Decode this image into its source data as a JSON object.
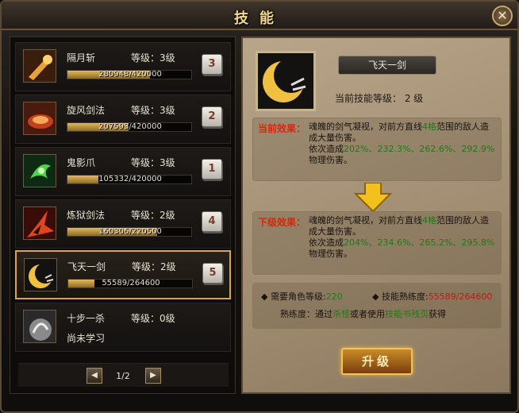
{
  "window": {
    "title": "技能",
    "close_symbol": "✕"
  },
  "skills": [
    {
      "name": "隔月斩",
      "level": "等级：3级",
      "progress": "280948/420000",
      "fraction": 0.669,
      "key": "3",
      "learned": true
    },
    {
      "name": "旋风剑法",
      "level": "等级：3级",
      "progress": "207593/420000",
      "fraction": 0.494,
      "key": "2",
      "learned": true
    },
    {
      "name": "鬼影爪",
      "level": "等级：3级",
      "progress": "105332/420000",
      "fraction": 0.251,
      "key": "1",
      "learned": true
    },
    {
      "name": "炼狱剑法",
      "level": "等级：2级",
      "progress": "160306/220500",
      "fraction": 0.727,
      "key": "4",
      "learned": true
    },
    {
      "name": "飞天一剑",
      "level": "等级：2级",
      "progress": "55589/264600",
      "fraction": 0.21,
      "key": "5",
      "learned": true,
      "selected": true
    },
    {
      "name": "十步一杀",
      "level": "等级：0级",
      "status": "尚未学习",
      "learned": false
    }
  ],
  "pager": {
    "text": "1/2",
    "prev_icon": "◀",
    "next_icon": "▶"
  },
  "detail": {
    "skill_name": "飞天一剑",
    "current_level": "当前技能等级： 2 级",
    "current_effect_label": "当前效果：",
    "current_effect_a": "魂魄的剑气凝视，对前方直线",
    "current_effect_range": "4格",
    "current_effect_b": "范围的敌人造成大量伤害。",
    "current_effect_c": "依次造成",
    "current_effect_vals": "202%、232.3%、262.6%、292.9%",
    "current_effect_d": "物理伤害。",
    "next_effect_label": "下级效果：",
    "next_effect_a": "魂魄的剑气凝视，对前方直线",
    "next_effect_range": "4格",
    "next_effect_b": "范围的敌人造成大量伤害。",
    "next_effect_c": "依次造成",
    "next_effect_vals": "204%、234.6%、265.2%、295.8%",
    "next_effect_d": "物理伤害。",
    "req_level_label": "需要角色等级:",
    "req_level_value": "220",
    "proficiency_label": "技能熟练度:",
    "proficiency_value": "55589/264600",
    "hint_a": "熟练度：通过",
    "hint_b": "杀怪",
    "hint_c": "或者使用",
    "hint_d": "技能书残页",
    "hint_e": "获得",
    "upgrade_label": "升级"
  },
  "colors": {
    "accent": "#d9a642",
    "green": "#1f7a12",
    "red": "#d22b0c"
  }
}
